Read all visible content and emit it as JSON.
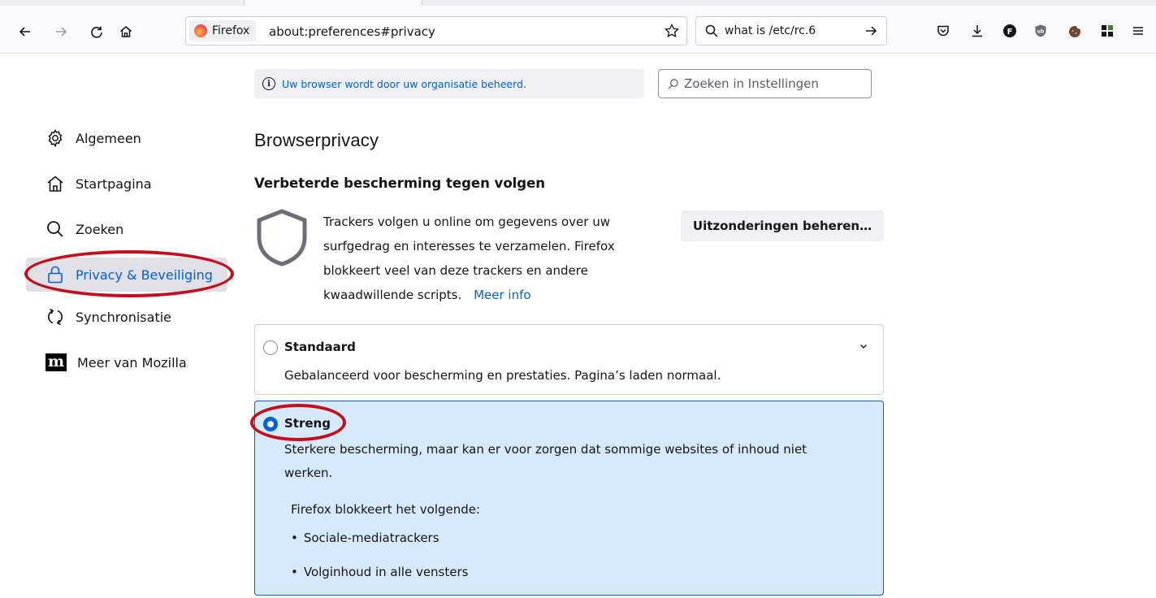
{
  "browser": {
    "identity_label": "Firefox",
    "url": "about:preferences#privacy",
    "search_text": "what is /etc/rc.6",
    "icons": [
      "back-icon",
      "forward-icon",
      "reload-icon",
      "home-icon",
      "star-icon",
      "pocket-icon",
      "download-icon",
      "extension-f-icon",
      "ublock-icon",
      "cookie-icon",
      "grid-extension-icon",
      "menu-icon"
    ]
  },
  "notice": {
    "text": "Uw browser wordt door uw organisatie beheerd."
  },
  "prefs_search": {
    "placeholder": "Zoeken in Instellingen"
  },
  "sidebar": {
    "items": [
      {
        "label": "Algemeen",
        "icon": "gear-icon"
      },
      {
        "label": "Startpagina",
        "icon": "home-icon"
      },
      {
        "label": "Zoeken",
        "icon": "search-icon"
      },
      {
        "label": "Privacy & Beveiliging",
        "icon": "lock-icon",
        "selected": true
      },
      {
        "label": "Synchronisatie",
        "icon": "sync-icon"
      },
      {
        "label": "Meer van Mozilla",
        "icon": "mozilla-icon"
      }
    ]
  },
  "main": {
    "title": "Browserprivacy",
    "etp_heading": "Verbeterde bescherming tegen volgen",
    "etp_description": "Trackers volgen u online om gegevens over uw surfgedrag en interesses te verzamelen. Firefox blokkeert veel van deze trackers en andere kwaadwillende scripts.",
    "meer_info": "Meer info",
    "exceptions_button": "Uitzonderingen beheren…",
    "standard": {
      "title": "Standaard",
      "description": "Gebalanceerd voor bescherming en prestaties. Pagina’s laden normaal."
    },
    "strict": {
      "title": "Streng",
      "description": "Sterkere bescherming, maar kan er voor zorgen dat sommige websites of inhoud niet werken.",
      "blocks_heading": "Firefox blokkeert het volgende:",
      "blocks": [
        "Sociale-mediatrackers",
        "Volginhoud in alle vensters"
      ]
    }
  },
  "colors": {
    "accent": "#0061e0",
    "selected_card_bg": "#d7e9fd",
    "annotation": "#c40e1c"
  }
}
